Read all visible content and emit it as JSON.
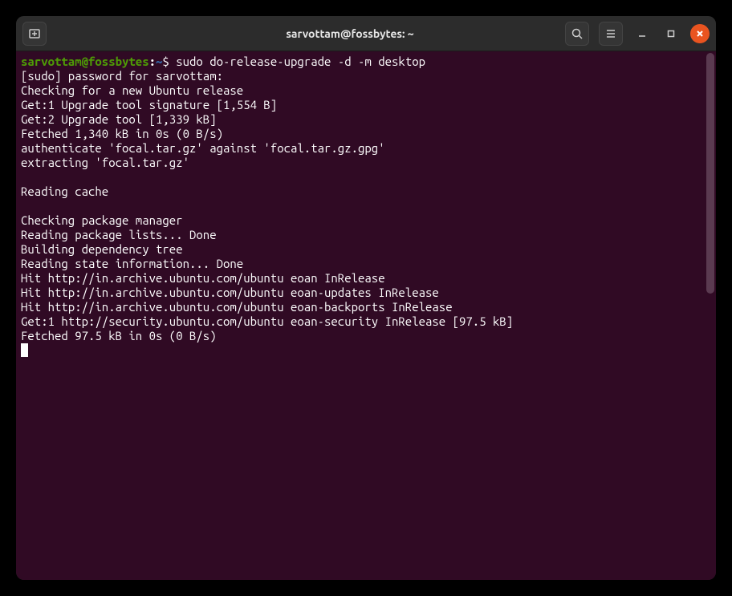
{
  "window": {
    "title": "sarvottam@fossbytes: ~"
  },
  "prompt": {
    "user_host": "sarvottam@fossbytes",
    "colon": ":",
    "path": "~",
    "dollar": "$ ",
    "command": "sudo do-release-upgrade -d -m desktop"
  },
  "output": {
    "lines": [
      "[sudo] password for sarvottam: ",
      "Checking for a new Ubuntu release",
      "Get:1 Upgrade tool signature [1,554 B]",
      "Get:2 Upgrade tool [1,339 kB]",
      "Fetched 1,340 kB in 0s (0 B/s)",
      "authenticate 'focal.tar.gz' against 'focal.tar.gz.gpg'",
      "extracting 'focal.tar.gz'",
      "",
      "Reading cache",
      "",
      "Checking package manager",
      "Reading package lists... Done",
      "Building dependency tree",
      "Reading state information... Done",
      "Hit http://in.archive.ubuntu.com/ubuntu eoan InRelease",
      "Hit http://in.archive.ubuntu.com/ubuntu eoan-updates InRelease",
      "Hit http://in.archive.ubuntu.com/ubuntu eoan-backports InRelease",
      "Get:1 http://security.ubuntu.com/ubuntu eoan-security InRelease [97.5 kB]",
      "Fetched 97.5 kB in 0s (0 B/s)"
    ]
  }
}
